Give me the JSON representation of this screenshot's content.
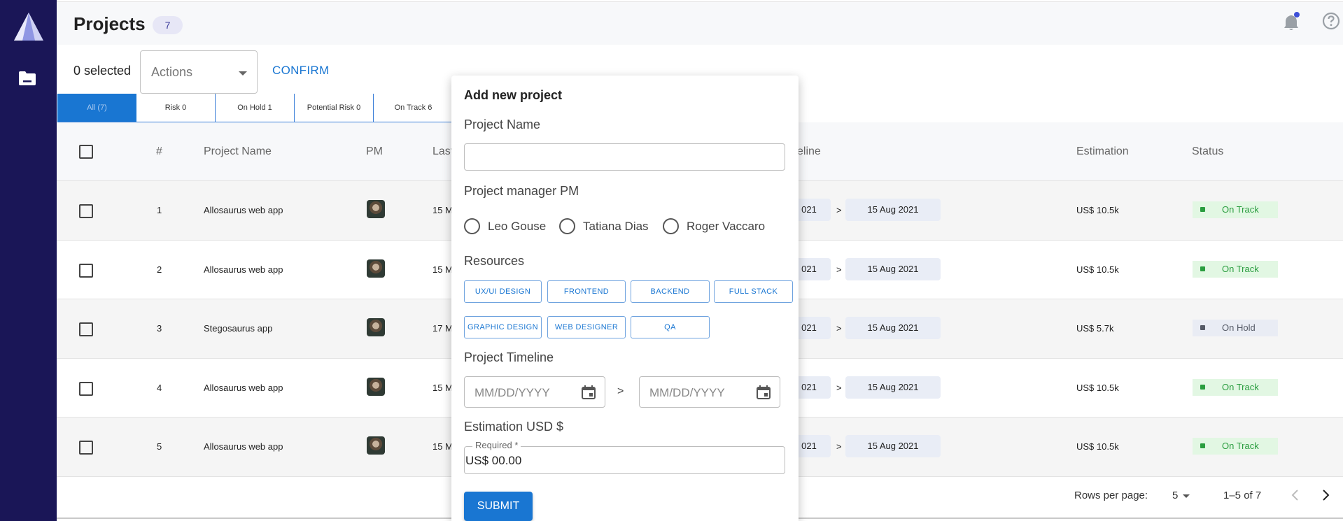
{
  "header": {
    "title": "Projects",
    "count": "7"
  },
  "toolbar": {
    "selected_text": "0 selected",
    "actions_placeholder": "Actions",
    "confirm_label": "CONFIRM"
  },
  "tabs": [
    {
      "label": "All (7)"
    },
    {
      "label": "Risk  0"
    },
    {
      "label": "On Hold  1"
    },
    {
      "label": "Potential Risk  0"
    },
    {
      "label": "On Track  6"
    }
  ],
  "table": {
    "headers": {
      "number": "#",
      "name": "Project Name",
      "pm": "PM",
      "last": "Last",
      "timeline": "eline",
      "estimation": "Estimation",
      "status": "Status"
    },
    "rows": [
      {
        "num": "1",
        "name": "Allosaurus web app",
        "last": "15 M",
        "start": "021",
        "end": "15 Aug 2021",
        "estimation": "US$ 10.5k",
        "status": "On Track"
      },
      {
        "num": "2",
        "name": "Allosaurus web app",
        "last": "15 M",
        "start": "021",
        "end": "15 Aug 2021",
        "estimation": "US$ 10.5k",
        "status": "On Track"
      },
      {
        "num": "3",
        "name": "Stegosaurus app",
        "last": "17 M",
        "start": "021",
        "end": "15 Aug 2021",
        "estimation": "US$ 5.7k",
        "status": "On Hold"
      },
      {
        "num": "4",
        "name": "Allosaurus web app",
        "last": "15 M",
        "start": "021",
        "end": "15 Aug 2021",
        "estimation": "US$ 10.5k",
        "status": "On Track"
      },
      {
        "num": "5",
        "name": "Allosaurus web app",
        "last": "15 M",
        "start": "021",
        "end": "15 Aug 2021",
        "estimation": "US$ 10.5k",
        "status": "On Track"
      }
    ],
    "date_separator": ">"
  },
  "pagination": {
    "rows_per_page_label": "Rows per page:",
    "rows_per_page_value": "5",
    "range": "1–5 of 7"
  },
  "modal": {
    "title": "Add new project",
    "project_name_label": "Project Name",
    "pm_label": "Project manager PM",
    "pm_options": [
      "Leo Gouse",
      "Tatiana Dias",
      "Roger Vaccaro"
    ],
    "resources_label": "Resources",
    "resources": [
      "UX/UI DESIGN",
      "FRONTEND",
      "BACKEND",
      "FULL STACK",
      "GRAPHIC DESIGN",
      "WEB DESIGNER",
      "QA"
    ],
    "timeline_label": "Project Timeline",
    "date_placeholder": "MM/DD/YYYY",
    "timeline_separator": ">",
    "estimation_label": "Estimation USD $",
    "estimation_legend": "Required *",
    "estimation_value": "US$ 00.00",
    "submit_label": "SUBMIT"
  },
  "colors": {
    "sidebar": "#1a1657",
    "primary": "#1976d2",
    "on_track": "#2a9d3f",
    "on_hold": "#555a66"
  },
  "icons": [
    "logo-icon",
    "folder-icon",
    "bell-icon",
    "help-icon",
    "calendar-icon",
    "chevron-left-icon",
    "chevron-right-icon"
  ]
}
